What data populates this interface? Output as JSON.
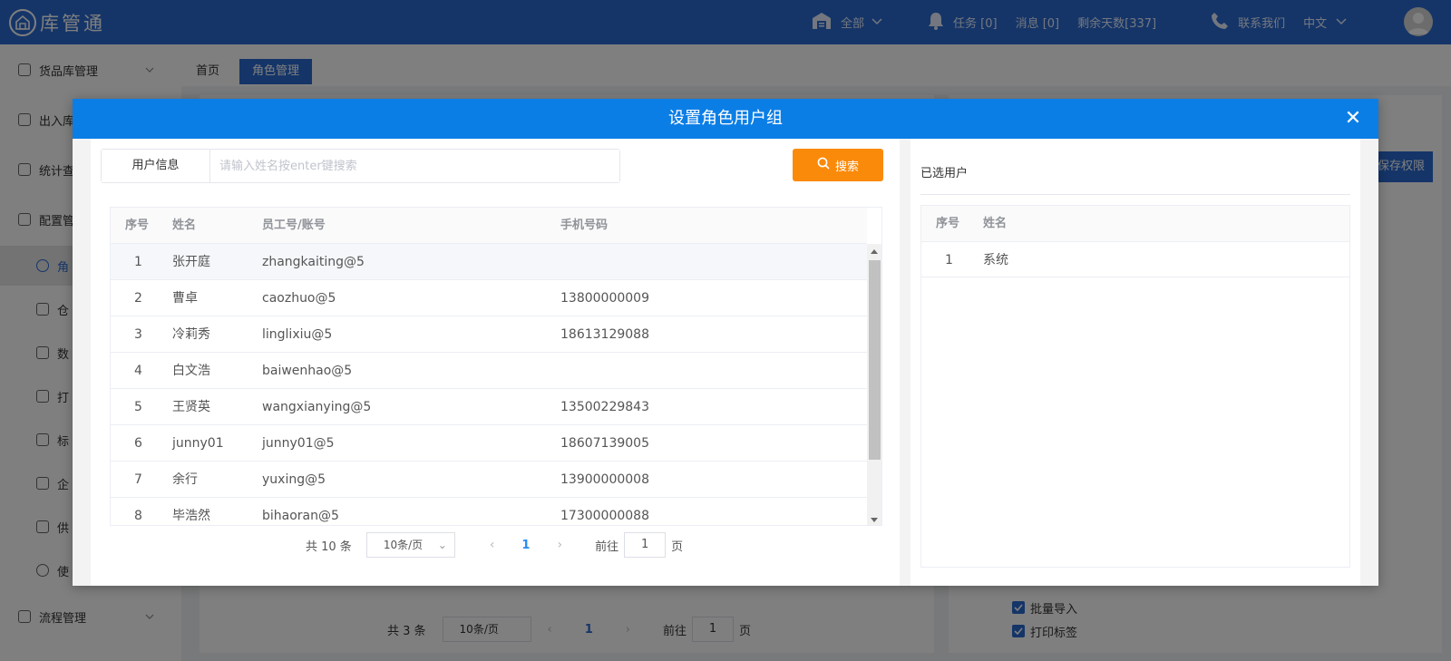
{
  "app": {
    "name": "库管通"
  },
  "header": {
    "scope_label": "全部",
    "tasks_label": "任务 [0]",
    "messages_label": "消息 [0]",
    "days_left_label": "剩余天数[337]",
    "contact_label": "联系我们",
    "language_label": "中文"
  },
  "sidebar": {
    "items": [
      {
        "label": "货品库管理"
      },
      {
        "label": "出入库"
      },
      {
        "label": "统计查"
      },
      {
        "label": "配置管"
      },
      {
        "label": "角"
      },
      {
        "label": "仓"
      },
      {
        "label": "数"
      },
      {
        "label": "打"
      },
      {
        "label": "标"
      },
      {
        "label": "企"
      },
      {
        "label": "供"
      },
      {
        "label": "使"
      },
      {
        "label": "流程管理"
      }
    ]
  },
  "tabs": [
    {
      "label": "首页"
    },
    {
      "label": "角色管理"
    }
  ],
  "background": {
    "save_label": "保存权限",
    "pager": {
      "total": "共 3 条",
      "page_size": "10条/页",
      "current": "1",
      "goto_prefix": "前往",
      "goto_value": "1",
      "goto_suffix": "页"
    },
    "permissions": [
      {
        "label": "批量导入"
      },
      {
        "label": "打印标签"
      }
    ]
  },
  "modal": {
    "title": "设置角色用户组",
    "close_glyph": "✕",
    "search": {
      "label": "用户信息",
      "placeholder": "请输入姓名按enter键搜索",
      "button_label": "搜索"
    },
    "table": {
      "headers": [
        "序号",
        "姓名",
        "员工号/账号",
        "手机号码"
      ],
      "rows": [
        {
          "index": "1",
          "name": "张开庭",
          "account": "zhangkaiting@5",
          "phone": ""
        },
        {
          "index": "2",
          "name": "曹卓",
          "account": "caozhuo@5",
          "phone": "13800000009"
        },
        {
          "index": "3",
          "name": "冷莉秀",
          "account": "linglixiu@5",
          "phone": "18613129088"
        },
        {
          "index": "4",
          "name": "白文浩",
          "account": "baiwenhao@5",
          "phone": ""
        },
        {
          "index": "5",
          "name": "王贤英",
          "account": "wangxianying@5",
          "phone": "13500229843"
        },
        {
          "index": "6",
          "name": "junny01",
          "account": "junny01@5",
          "phone": "18607139005"
        },
        {
          "index": "7",
          "name": "余行",
          "account": "yuxing@5",
          "phone": "13900000008"
        },
        {
          "index": "8",
          "name": "毕浩然",
          "account": "bihaoran@5",
          "phone": "17300000088"
        }
      ]
    },
    "pager": {
      "total": "共 10 条",
      "page_size": "10条/页",
      "prev_glyph": "‹",
      "current": "1",
      "next_glyph": "›",
      "goto_prefix": "前往",
      "goto_value": "1",
      "goto_suffix": "页"
    },
    "selected": {
      "title": "已选用户",
      "headers": [
        "序号",
        "姓名"
      ],
      "rows": [
        {
          "index": "1",
          "name": "系统"
        }
      ]
    }
  }
}
